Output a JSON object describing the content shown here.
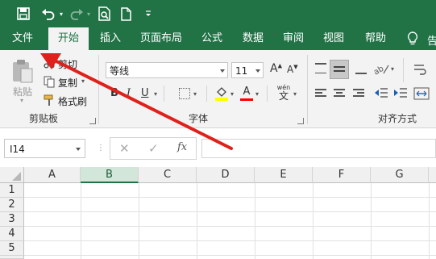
{
  "quick_access": {
    "save_icon": "save-icon",
    "undo_icon": "undo-icon",
    "redo_icon": "redo-icon",
    "print_preview_icon": "print-preview-icon",
    "new_icon": "new-document-icon"
  },
  "tabs": [
    {
      "label": "文件"
    },
    {
      "label": "开始"
    },
    {
      "label": "插入"
    },
    {
      "label": "页面布局"
    },
    {
      "label": "公式"
    },
    {
      "label": "数据"
    },
    {
      "label": "审阅"
    },
    {
      "label": "视图"
    },
    {
      "label": "帮助"
    }
  ],
  "active_tab": "开始",
  "clipboard": {
    "paste": "粘贴",
    "cut": "剪切",
    "copy": "复制",
    "format_painter": "格式刷",
    "group_label": "剪贴板"
  },
  "font": {
    "name": "等线",
    "size": "11",
    "grow": "A",
    "shrink": "A",
    "bold": "B",
    "italic": "I",
    "underline": "U",
    "font_color_letter": "A",
    "phonetic": "wén",
    "phonetic_char": "文",
    "group_label": "字体"
  },
  "alignment": {
    "group_label": "对齐方式"
  },
  "formula_bar": {
    "name_box": "I14",
    "fx": "fx",
    "value": ""
  },
  "grid": {
    "columns": [
      "A",
      "B",
      "C",
      "D",
      "E",
      "F",
      "G"
    ],
    "selected_column": "B",
    "rows": [
      "1",
      "2",
      "3",
      "4",
      "5"
    ]
  },
  "colors": {
    "excel_green": "#217346",
    "annotation_red": "#e0201b",
    "highlight_yellow": "#ffff00",
    "font_red": "#ff0000"
  }
}
